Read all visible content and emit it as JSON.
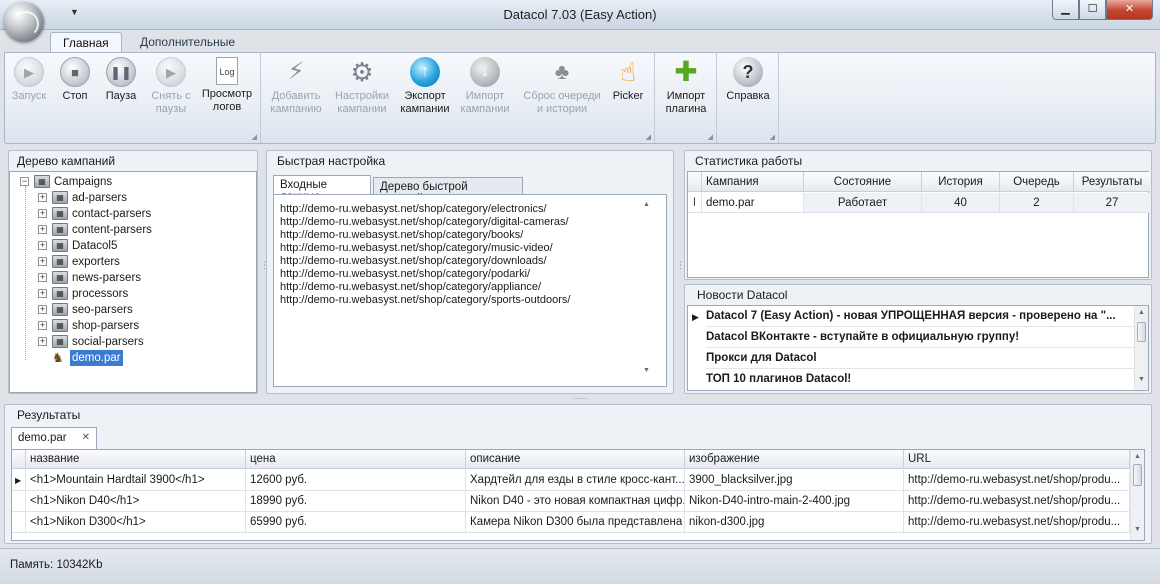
{
  "window": {
    "title": "Datacol 7.03 (Easy Action)",
    "min_symbol": "▁",
    "max_symbol": "☐",
    "close_symbol": "✕",
    "qat_symbol": "▼"
  },
  "ribbon": {
    "tabs": [
      "Главная",
      "Дополнительные"
    ],
    "active_tab": "Главная",
    "buttons": {
      "start": {
        "line1": "Запуск",
        "line2": "",
        "icon": "play-icon",
        "glyph": "▶",
        "enabled": false
      },
      "stop": {
        "line1": "Стоп",
        "line2": "",
        "icon": "stop-icon",
        "glyph": "■",
        "enabled": true
      },
      "pause": {
        "line1": "Пауза",
        "line2": "",
        "icon": "pause-icon",
        "glyph": "❚❚",
        "enabled": true
      },
      "unpause": {
        "line1": "Снять с",
        "line2": "паузы",
        "icon": "resume-icon",
        "glyph": "▶",
        "enabled": false
      },
      "logs": {
        "line1": "Просмотр",
        "line2": "логов",
        "icon": "log-document-icon",
        "glyph": "Log",
        "enabled": true
      },
      "add_campaign": {
        "line1": "Добавить",
        "line2": "кампанию",
        "icon": "magic-wand-icon",
        "glyph": "⚡",
        "enabled": false
      },
      "campaign_settings": {
        "line1": "Настройки",
        "line2": "кампании",
        "icon": "gear-icon",
        "glyph": "⚙",
        "enabled": false
      },
      "export": {
        "line1": "Экспорт",
        "line2": "кампании",
        "icon": "upload-arrow-icon",
        "glyph": "↑",
        "enabled": true
      },
      "import": {
        "line1": "Импорт",
        "line2": "кампании",
        "icon": "download-arrow-icon",
        "glyph": "↓",
        "enabled": false
      },
      "reset_queue": {
        "line1": "Сброс очереди",
        "line2": "и истории",
        "icon": "people-reset-icon",
        "glyph": "♣",
        "enabled": false
      },
      "picker": {
        "line1": "Picker",
        "line2": "",
        "icon": "pointing-hand-icon",
        "glyph": "☝",
        "enabled": true
      },
      "import_plugin": {
        "line1": "Импорт",
        "line2": "плагина",
        "icon": "puzzle-plugin-icon",
        "glyph": "✚",
        "enabled": true
      },
      "help": {
        "line1": "Справка",
        "line2": "",
        "icon": "help-icon",
        "glyph": "?",
        "enabled": true
      }
    }
  },
  "campaign_tree": {
    "title": "Дерево кампаний",
    "root": "Campaigns",
    "folders": [
      "ad-parsers",
      "contact-parsers",
      "content-parsers",
      "Datacol5",
      "exporters",
      "news-parsers",
      "processors",
      "seo-parsers",
      "shop-parsers",
      "social-parsers"
    ],
    "selected": "demo.par",
    "expand_glyph": "+",
    "collapse_glyph": "−"
  },
  "quick_setup": {
    "title": "Быстрая настройка",
    "tabs": [
      "Входные данные",
      "Дерево быстрой настройки"
    ],
    "active_tab": "Входные данные",
    "urls": [
      "http://demo-ru.webasyst.net/shop/category/electronics/",
      "http://demo-ru.webasyst.net/shop/category/digital-cameras/",
      "http://demo-ru.webasyst.net/shop/category/books/",
      "http://demo-ru.webasyst.net/shop/category/music-video/",
      "http://demo-ru.webasyst.net/shop/category/downloads/",
      "http://demo-ru.webasyst.net/shop/category/podarki/",
      "http://demo-ru.webasyst.net/shop/category/appliance/",
      "http://demo-ru.webasyst.net/shop/category/sports-outdoors/"
    ]
  },
  "stats": {
    "title": "Статистика работы",
    "columns": [
      "Кампания",
      "Состояние",
      "История",
      "Очередь",
      "Результаты"
    ],
    "rows": [
      [
        "demo.par",
        "Работает",
        "40",
        "2",
        "27"
      ]
    ],
    "row_marker": "I"
  },
  "news": {
    "title": "Новости Datacol",
    "items": [
      "Datacol 7 (Easy Action) - новая УПРОЩЕННАЯ версия - проверено на \"...",
      "Datacol ВКонтакте - вступайте в официальную группу!",
      "Прокси для Datacol",
      "ТОП 10 плагинов Datacol!"
    ],
    "row_marker": "▶"
  },
  "results": {
    "title": "Результаты",
    "tab_label": "demo.par",
    "tab_close": "✕",
    "columns": [
      "название",
      "цена",
      "описание",
      "изображение",
      "URL"
    ],
    "rows": [
      [
        "<h1>Mountain Hardtail 3900</h1>",
        "12600 руб.",
        "Хардтейл для езды в стиле кросс-кант...",
        "3900_blacksilver.jpg",
        "http://demo-ru.webasyst.net/shop/produ..."
      ],
      [
        "<h1>Nikon D40</h1>",
        "18990 руб.",
        "Nikon D40 - это новая компактная цифр...",
        "Nikon-D40-intro-main-2-400.jpg",
        "http://demo-ru.webasyst.net/shop/produ..."
      ],
      [
        "<h1>Nikon D300</h1>",
        "65990 руб.",
        "Камера Nikon D300 была представлена ...",
        "nikon-d300.jpg",
        "http://demo-ru.webasyst.net/shop/produ..."
      ]
    ],
    "row_marker": "▶"
  },
  "status": {
    "memory": "Память: 10342Kb"
  }
}
